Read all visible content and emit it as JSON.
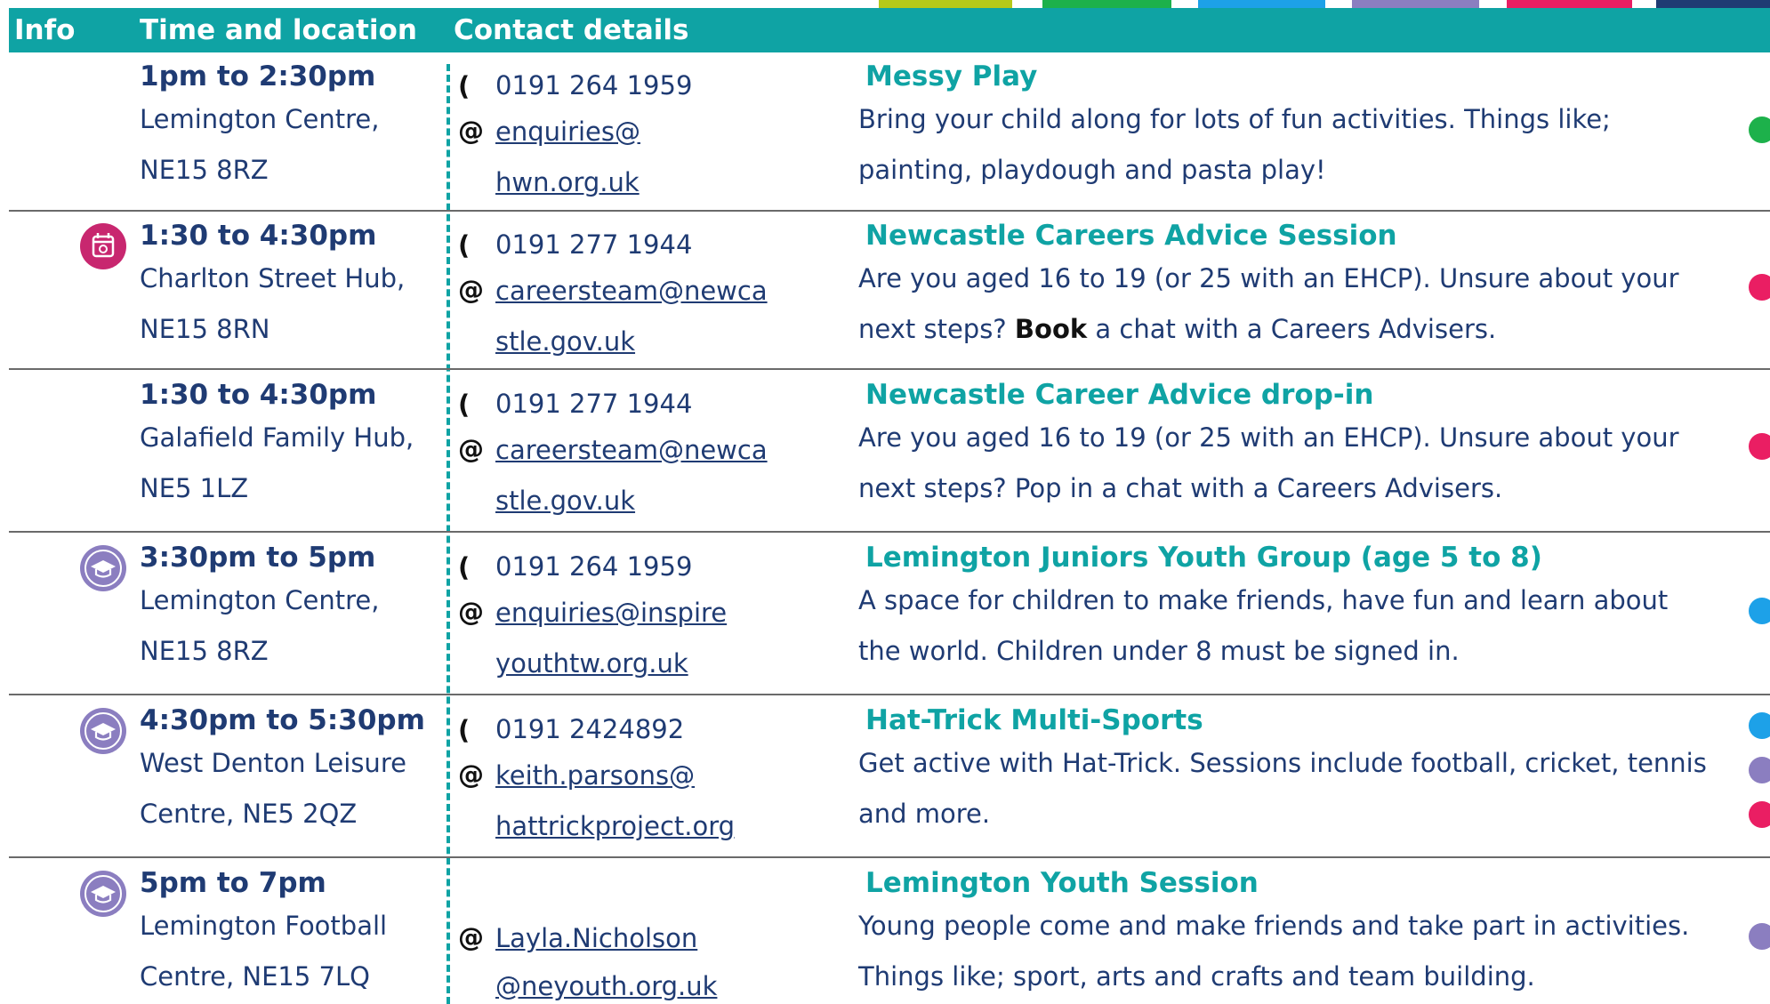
{
  "colors": {
    "teal": "#0fa3a4",
    "navy": "#1f3b73",
    "green": "#1db14b",
    "pink": "#ea1e63",
    "blue": "#1da1e8",
    "purple": "#8b7ec0",
    "magenta": "#c8276f",
    "lime": "#b5c91a"
  },
  "header": {
    "info": "Info",
    "time_location": "Time and location",
    "contact_details": "Contact details"
  },
  "rows": [
    {
      "time": "1pm to 2:30pm",
      "place_line1": "Lemington Centre,",
      "place_line2": "NE15 8RZ",
      "phone": "0191 264 1959",
      "email_line1": "enquiries@",
      "email_line2": "hwn.org.uk",
      "title": "Messy Play",
      "desc_line1": "Bring your child along for lots of fun activities. Things like;",
      "desc_line2": "painting, playdough and pasta play!"
    },
    {
      "icon": "calendar-booking-icon",
      "time": "1:30 to 4:30pm",
      "place_line1": "Charlton Street Hub,",
      "place_line2": "NE15 8RN",
      "phone": "0191 277 1944",
      "email_line1": "careersteam@newca",
      "email_line2": "stle.gov.uk",
      "title": "Newcastle Careers Advice Session",
      "desc_line1": "Are you aged 16 to 19 (or 25 with an EHCP). Unsure about your",
      "desc_line2_pre": "next steps? ",
      "desc_line2_bold": "Book",
      "desc_line2_post": " a chat with a Careers Advisers."
    },
    {
      "time": "1:30 to 4:30pm",
      "place_line1": "Galafield Family Hub,",
      "place_line2": "NE5 1LZ",
      "phone": "0191 277 1944",
      "email_line1": "careersteam@newca",
      "email_line2": "stle.gov.uk",
      "title": "Newcastle Career Advice drop-in",
      "desc_line1": "Are you aged 16 to 19 (or 25 with an EHCP). Unsure about your",
      "desc_line2": "next steps? Pop in a chat with a Careers Advisers."
    },
    {
      "icon": "graduation-cap-icon",
      "time": "3:30pm to 5pm",
      "place_line1": "Lemington Centre,",
      "place_line2": "NE15 8RZ",
      "phone": "0191 264 1959",
      "email_line1": "enquiries@inspire",
      "email_line2": "youthtw.org.uk",
      "title": "Lemington Juniors Youth Group (age 5 to 8)",
      "desc_line1": "A space for children to make friends, have fun and learn about",
      "desc_line2": "the world. Children under 8 must be signed in."
    },
    {
      "icon": "graduation-cap-icon",
      "time": "4:30pm to 5:30pm",
      "place_line1": "West Denton Leisure",
      "place_line2": "Centre, NE5 2QZ",
      "phone": "0191 2424892",
      "email_line1": "keith.parsons@",
      "email_line2": "hattrickproject.org",
      "title": "Hat-Trick Multi-Sports",
      "desc_line1": "Get active with Hat-Trick. Sessions include football, cricket, tennis",
      "desc_line2": "and more."
    },
    {
      "icon": "graduation-cap-icon",
      "time": "5pm to 7pm",
      "place_line1": "Lemington Football",
      "place_line2": "Centre, NE15 7LQ",
      "email_line1": "Layla.Nicholson",
      "email_line2": "@neyouth.org.uk",
      "title": "Lemington Youth Session",
      "desc_line1": "Young people come and make friends and take part in activities.",
      "desc_line2": "Things like; sport, arts and crafts and team building."
    }
  ]
}
